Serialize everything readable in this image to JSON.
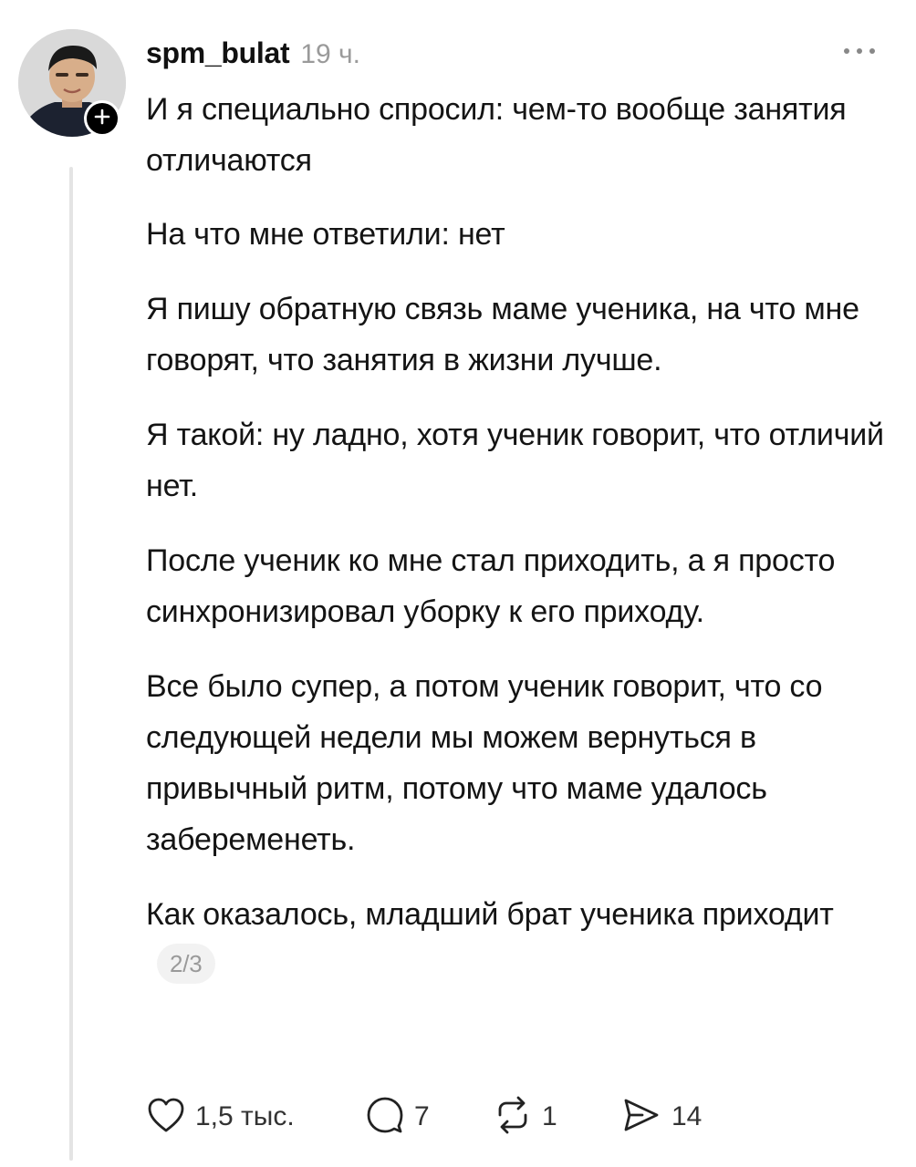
{
  "post": {
    "username": "spm_bulat",
    "time": "19 ч.",
    "paragraphs": [
      "И я специально спросил: чем-то вообще занятия отличаются",
      "На что мне ответили: нет",
      "Я пишу обратную связь маме ученика, на что мне говорят, что занятия в жизни лучше.",
      "Я такой: ну ладно, хотя ученик говорит, что отличий нет.",
      "После ученик ко мне стал приходить, а я просто синхронизировал уборку к его приходу.",
      "Все было супер, а потом ученик говорит, что со следующей недели мы можем вернуться в привычный ритм, потому что маме удалось забеременеть.",
      "Как оказалось, младший брат ученика приходит"
    ],
    "thread_counter": "2/3"
  },
  "actions": {
    "likes": "1,5 тыс.",
    "replies": "7",
    "reposts": "1",
    "shares": "14"
  },
  "icons": {
    "avatar": "user-avatar",
    "follow": "plus-icon",
    "more": "more-horizontal-icon",
    "like": "heart-icon",
    "reply": "comment-icon",
    "repost": "repost-icon",
    "share": "send-icon"
  },
  "colors": {
    "text": "#141414",
    "muted": "#9a9a9a",
    "thread_line": "#e4e4e4",
    "badge": "#000000"
  }
}
